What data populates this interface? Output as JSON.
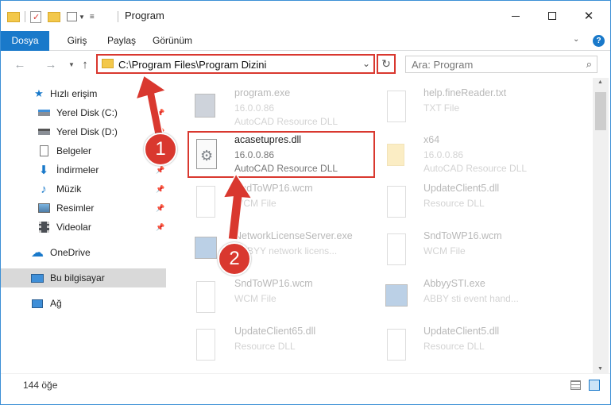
{
  "window": {
    "title": "Program"
  },
  "ribbon": {
    "tabs": [
      "Dosya",
      "Giriş",
      "Paylaş",
      "Görünüm"
    ]
  },
  "address": {
    "path": "C:\\Program Files\\Program Dizini"
  },
  "search": {
    "placeholder": "Ara: Program"
  },
  "nav": {
    "quick_access": "Hızlı erişim",
    "items": [
      "Yerel Disk (C:)",
      "Yerel Disk (D:)",
      "Belgeler",
      "İndirmeler",
      "Müzik",
      "Resimler",
      "Videolar"
    ],
    "onedrive": "OneDrive",
    "this_pc": "Bu bilgisayar",
    "network": "Ağ"
  },
  "files": [
    {
      "name": "program.exe",
      "version": "16.0.0.86",
      "desc": "AutoCAD Resource DLL"
    },
    {
      "name": "help.fineReader.txt",
      "version": "",
      "desc": "TXT File"
    },
    {
      "name": "acasetupres.dll",
      "version": "16.0.0.86",
      "desc": "AutoCAD Resource DLL"
    },
    {
      "name": "x64",
      "version": "16.0.0.86",
      "desc": "AutoCAD Resource DLL"
    },
    {
      "name": "SndToWP16.wcm",
      "version": "",
      "desc": "WCM File"
    },
    {
      "name": "UpdateClient5.dll",
      "version": "",
      "desc": "Resource DLL"
    },
    {
      "name": "NetworkLicenseServer.exe",
      "version": "",
      "desc": "ABBYY network licens..."
    },
    {
      "name": "SndToWP16.wcm",
      "version": "",
      "desc": "WCM File"
    },
    {
      "name": "SndToWP16.wcm",
      "version": "",
      "desc": "WCM File"
    },
    {
      "name": "AbbyySTI.exe",
      "version": "",
      "desc": "ABBY sti event hand..."
    },
    {
      "name": "UpdateClient65.dll",
      "version": "",
      "desc": "Resource DLL"
    },
    {
      "name": "UpdateClient5.dll",
      "version": "",
      "desc": "Resource DLL"
    }
  ],
  "status": {
    "count": "144 öğe"
  },
  "annotations": [
    "1",
    "2"
  ],
  "colors": {
    "accent": "#1979ca",
    "highlight": "#d9382f",
    "folder": "#f3c84b"
  }
}
